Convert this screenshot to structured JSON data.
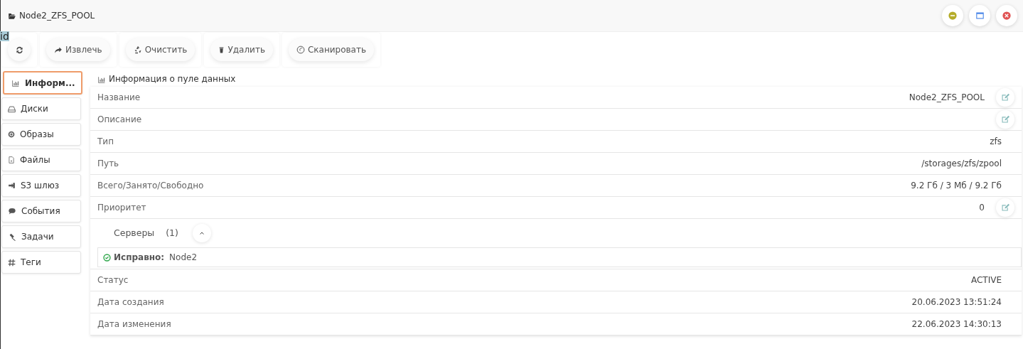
{
  "window": {
    "title": "Node2_ZFS_POOL",
    "controls": [
      {
        "kind": "minimize"
      },
      {
        "kind": "maximize"
      },
      {
        "kind": "close"
      }
    ]
  },
  "selected_text": "id",
  "toolbar": [
    {
      "kind": "refresh"
    },
    {
      "kind": "extract",
      "label": "Извлечь"
    },
    {
      "kind": "clean",
      "label": "Очистить"
    },
    {
      "kind": "delete",
      "label": "Удалить"
    },
    {
      "kind": "scan",
      "label": "Сканировать"
    }
  ],
  "sidebar": {
    "items": [
      {
        "kind": "info",
        "label": "Информ...",
        "selected": true
      },
      {
        "kind": "disks",
        "label": "Диски",
        "selected": false
      },
      {
        "kind": "images",
        "label": "Образы",
        "selected": false
      },
      {
        "kind": "files",
        "label": "Файлы",
        "selected": false
      },
      {
        "kind": "s3",
        "label": "S3 шлюз",
        "selected": false
      },
      {
        "kind": "events",
        "label": "События",
        "selected": false
      },
      {
        "kind": "tasks",
        "label": "Задачи",
        "selected": false
      },
      {
        "kind": "tags",
        "label": "Теги",
        "selected": false
      }
    ]
  },
  "panel": {
    "title": "Информация о пуле данных",
    "rows": [
      {
        "label": "Название",
        "value": "Node2_ZFS_POOL",
        "editable": true
      },
      {
        "label": "Описание",
        "editable": true
      },
      {
        "label": "Тип",
        "value": "zfs",
        "editable": false
      },
      {
        "label": "Путь",
        "value": "/storages/zfs/zpool",
        "editable": false
      },
      {
        "label": "Всего/Занято/Свободно",
        "value": "9.2 Гб / 3 Мб / 9.2 Гб",
        "editable": false
      },
      {
        "label": "Приоритет",
        "value": "0",
        "editable": true
      }
    ],
    "servers": {
      "label": "Серверы",
      "count": "(1)",
      "expanded": true,
      "items": [
        {
          "status": "Исправно:",
          "node": "Node2"
        }
      ]
    },
    "rows_after": [
      {
        "label": "Статус",
        "value": "ACTIVE",
        "editable": false
      },
      {
        "label": "Дата создания",
        "value": "20.06.2023 13:51:24",
        "editable": false
      },
      {
        "label": "Дата изменения",
        "value": "22.06.2023 14:30:13",
        "editable": false
      }
    ]
  }
}
